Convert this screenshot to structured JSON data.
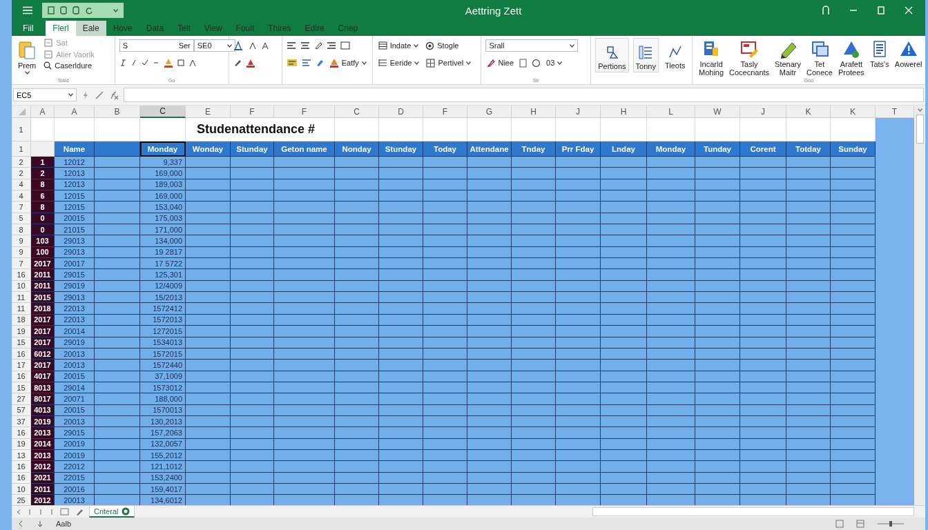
{
  "window": {
    "title": "Aettring Zett"
  },
  "file_tab": "Fiil",
  "tabs": [
    {
      "label": "Flerl",
      "selected": true,
      "highlighted": false
    },
    {
      "label": "Eale",
      "selected": false,
      "highlighted": true
    },
    {
      "label": "Hove",
      "selected": false,
      "highlighted": false
    },
    {
      "label": "Data",
      "selected": false,
      "highlighted": false
    },
    {
      "label": "Telt",
      "selected": false,
      "highlighted": false
    },
    {
      "label": "View",
      "selected": false,
      "highlighted": false
    },
    {
      "label": "Foult",
      "selected": false,
      "highlighted": false
    },
    {
      "label": "Thires",
      "selected": false,
      "highlighted": false
    },
    {
      "label": "Edire",
      "selected": false,
      "highlighted": false
    },
    {
      "label": "Cnep",
      "selected": false,
      "highlighted": false
    }
  ],
  "ribbon": {
    "clipboard": {
      "paste": "Prem",
      "items": [
        "Sat",
        "Alier Vaorlk",
        "Caserldure"
      ],
      "label": "Tosld"
    },
    "font": {
      "font": "S",
      "style": "Ser",
      "size": "SE0",
      "label": "Go"
    },
    "alignment": {
      "wrap": "Eatfy"
    },
    "cells": {
      "items": [
        "Indate",
        "Stogle",
        "Eeride",
        "Pertivel"
      ]
    },
    "styles": {
      "style": "Srall",
      "find": "Niee",
      "reading": "03",
      "label": "Sir"
    },
    "commands": [
      "Pertions",
      "Tonny",
      "Tieots"
    ],
    "tools": [
      "Incarld Mohing",
      "Tasly Cocecnants",
      "Stenary Maitr",
      "Tet Conece",
      "Arafett Protees",
      "Tats's",
      "Aowerel"
    ],
    "tools_label": "Goo"
  },
  "formula_bar": {
    "name_box": "EC5"
  },
  "sheet": {
    "columns": [
      {
        "letter": "A",
        "selected": false
      },
      {
        "letter": "A",
        "selected": false
      },
      {
        "letter": "B",
        "selected": false
      },
      {
        "letter": "C",
        "selected": true
      },
      {
        "letter": "E",
        "selected": false
      },
      {
        "letter": "F",
        "selected": false
      },
      {
        "letter": "F",
        "selected": false
      },
      {
        "letter": "C",
        "selected": false
      },
      {
        "letter": "D",
        "selected": false
      },
      {
        "letter": "F",
        "selected": false
      },
      {
        "letter": "G",
        "selected": false
      },
      {
        "letter": "H",
        "selected": false
      },
      {
        "letter": "J",
        "selected": false
      },
      {
        "letter": "H",
        "selected": false
      },
      {
        "letter": "L",
        "selected": false
      },
      {
        "letter": "W",
        "selected": false
      },
      {
        "letter": "J",
        "selected": false
      },
      {
        "letter": "K",
        "selected": false
      },
      {
        "letter": "K",
        "selected": false
      },
      {
        "letter": "T",
        "selected": false
      }
    ],
    "title_row": "1",
    "title": "Studenattendance #",
    "header_row": "1",
    "headers": [
      {
        "selected": false
      },
      {
        "text": "Name",
        "selected": false
      },
      {
        "selected": false
      },
      {
        "text": "Monday",
        "selected": true
      },
      {
        "text": "Wonday",
        "selected": false
      },
      {
        "text": "Stunday",
        "selected": false
      },
      {
        "text": "Geton name",
        "selected": false
      },
      {
        "text": "Nonday",
        "selected": false
      },
      {
        "text": "Stunday",
        "selected": false
      },
      {
        "text": "Today",
        "selected": false
      },
      {
        "text": "Attendane",
        "selected": false
      },
      {
        "text": "Tnday",
        "selected": false
      },
      {
        "text": "Prr Fday",
        "selected": false
      },
      {
        "text": "Lnday",
        "selected": false
      },
      {
        "text": "Monday",
        "selected": false
      },
      {
        "text": "Tunday",
        "selected": false
      },
      {
        "text": "Corent",
        "selected": false
      },
      {
        "text": "Totday",
        "selected": false
      },
      {
        "text": "Sunday",
        "selected": false
      }
    ],
    "rows": [
      {
        "row": "2",
        "id": "1",
        "year": "12012",
        "value": "9,337"
      },
      {
        "row": "2",
        "id": "2",
        "year": "12013",
        "value": "169,000"
      },
      {
        "row": "4",
        "id": "8",
        "year": "12013",
        "value": "189,003"
      },
      {
        "row": "4",
        "id": "6",
        "year": "12015",
        "value": "169,000"
      },
      {
        "row": "7",
        "id": "8",
        "year": "12015",
        "value": "153,040"
      },
      {
        "row": "5",
        "id": "0",
        "year": "20015",
        "value": "175,003"
      },
      {
        "row": "8",
        "id": "0",
        "year": "21015",
        "value": "171,000"
      },
      {
        "row": "9",
        "id": "103",
        "year": "29013",
        "value": "134,000"
      },
      {
        "row": "9",
        "id": "100",
        "year": "29013",
        "value": "19 2817"
      },
      {
        "row": "7",
        "id": "2017",
        "year": "20017",
        "value": "17 5722"
      },
      {
        "row": "16",
        "id": "2011",
        "year": "29015",
        "value": "125,301"
      },
      {
        "row": "10",
        "id": "2011",
        "year": "29019",
        "value": "12/4009"
      },
      {
        "row": "11",
        "id": "2015",
        "year": "29013",
        "value": "15/2013"
      },
      {
        "row": "11",
        "id": "2018",
        "year": "22013",
        "value": "1572412"
      },
      {
        "row": "18",
        "id": "2017",
        "year": "22013",
        "value": "1572013"
      },
      {
        "row": "19",
        "id": "2017",
        "year": "20014",
        "value": "1272015"
      },
      {
        "row": "15",
        "id": "2017",
        "year": "29019",
        "value": "1534013"
      },
      {
        "row": "16",
        "id": "6012",
        "year": "20013",
        "value": "1572015"
      },
      {
        "row": "17",
        "id": "2017",
        "year": "20013",
        "value": "1572440"
      },
      {
        "row": "16",
        "id": "4017",
        "year": "20015",
        "value": "37,1009"
      },
      {
        "row": "15",
        "id": "8013",
        "year": "29014",
        "value": "1573012"
      },
      {
        "row": "27",
        "id": "8017",
        "year": "20071",
        "value": "188,000"
      },
      {
        "row": "57",
        "id": "4013",
        "year": "20015",
        "value": "1570013"
      },
      {
        "row": "37",
        "id": "2019",
        "year": "20013",
        "value": "130,2013"
      },
      {
        "row": "16",
        "id": "2013",
        "year": "29015",
        "value": "157,2063"
      },
      {
        "row": "19",
        "id": "2014",
        "year": "20019",
        "value": "132,0057"
      },
      {
        "row": "13",
        "id": "2013",
        "year": "20019",
        "value": "155,2012"
      },
      {
        "row": "16",
        "id": "2012",
        "year": "22012",
        "value": "121,1012"
      },
      {
        "row": "16",
        "id": "2021",
        "year": "22015",
        "value": "153,2400"
      },
      {
        "row": "10",
        "id": "2011",
        "year": "20016",
        "value": "159,4017"
      },
      {
        "row": "25",
        "id": "2012",
        "year": "20013",
        "value": "134,6012"
      }
    ]
  },
  "sheet_tabs": [
    {
      "label": "Cnteral",
      "selected": true
    }
  ],
  "status_bar": {
    "text": "Aalb"
  }
}
